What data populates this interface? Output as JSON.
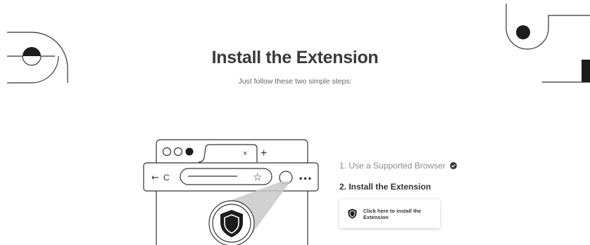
{
  "header": {
    "title": "Install the Extension",
    "subtitle": "Just follow these two simple steps:"
  },
  "steps": {
    "step1_label": "1. Use a Supported Browser",
    "step1_icon": "check-badge-icon",
    "step2_label": "2. Install the Extension"
  },
  "install_button": {
    "label": "Click here to install the Extension",
    "icon": "shield-icon"
  },
  "illustration": {
    "tab_close": "×",
    "new_tab": "+",
    "back": "←",
    "reload": "C",
    "star": "☆",
    "menu": "•••"
  },
  "colors": {
    "text_dark": "#3a3a3a",
    "text_muted": "#8a8a8a",
    "accent_dark": "#1e1e1e"
  }
}
